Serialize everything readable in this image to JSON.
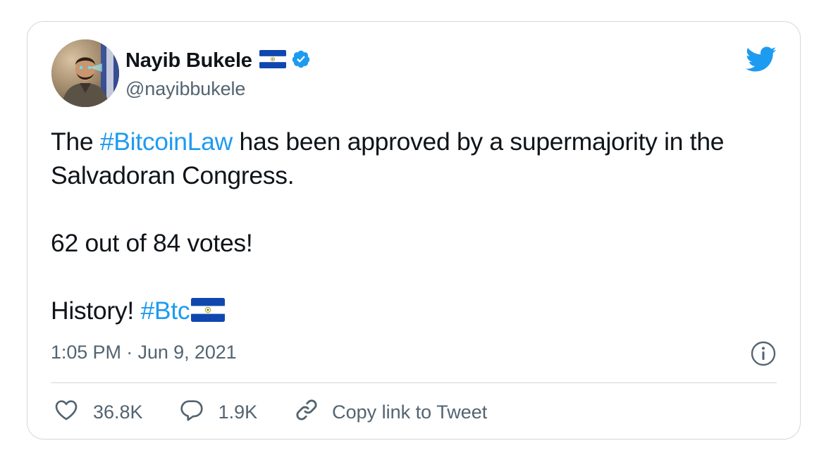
{
  "author": {
    "display_name": "Nayib Bukele",
    "handle": "@nayibbukele",
    "flag_icon": "el-salvador-flag-icon",
    "verified_icon": "verified-badge-icon"
  },
  "tweet": {
    "line1_before": "The ",
    "line1_hashtag": "#BitcoinLaw",
    "line1_after": " has been approved by a supermajority in the Salvadoran Congress.",
    "line2": "62 out of 84 votes!",
    "line3_before": "History! ",
    "line3_hashtag": "#Btc",
    "line3_flag_icon": "el-salvador-flag-icon"
  },
  "meta": {
    "timestamp": "1:05 PM · Jun 9, 2021",
    "info_icon": "info-icon",
    "brand_icon": "twitter-bird-icon"
  },
  "actions": {
    "likes_count": "36.8K",
    "replies_count": "1.9K",
    "copy_link_label": "Copy link to Tweet"
  },
  "colors": {
    "link": "#1d9bf0",
    "text": "#0f1419",
    "secondary": "#536471",
    "border": "#cfd9de",
    "verified": "#1d9bf0",
    "flag_blue": "#0f47af"
  }
}
